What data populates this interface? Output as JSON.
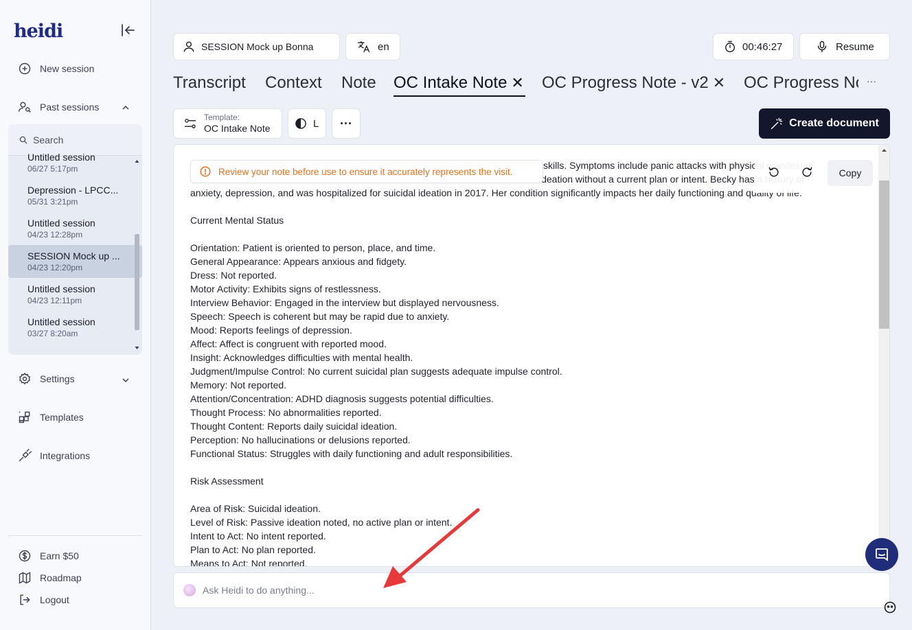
{
  "app": {
    "logo": "heidi"
  },
  "sidebar": {
    "new_session": "New session",
    "past_sessions": "Past sessions",
    "search_placeholder": "Search",
    "sessions": [
      {
        "title": "Untitled session",
        "date": "06/27 5:17pm"
      },
      {
        "title": "Depression - LPCC...",
        "date": "05/31 3:21pm"
      },
      {
        "title": "Untitled session",
        "date": "04/23 12:28pm"
      },
      {
        "title": "SESSION Mock up ...",
        "date": "04/23 12:20pm",
        "active": true
      },
      {
        "title": "Untitled session",
        "date": "04/23 12:11pm"
      },
      {
        "title": "Untitled session",
        "date": "03/27 8:20am"
      }
    ],
    "settings": "Settings",
    "templates": "Templates",
    "integrations": "Integrations",
    "earn": "Earn $50",
    "roadmap": "Roadmap",
    "logout": "Logout"
  },
  "topbar": {
    "session_name": "SESSION Mock up Bonna",
    "language": "en",
    "timer": "00:46:27",
    "resume": "Resume"
  },
  "tabs": [
    {
      "label": "Transcript"
    },
    {
      "label": "Context"
    },
    {
      "label": "Note"
    },
    {
      "label": "OC Intake Note",
      "closable": true,
      "active": true
    },
    {
      "label": "OC Progress Note - v2",
      "closable": true
    },
    {
      "label": "OC Progress Note"
    }
  ],
  "tabs_more": "···",
  "close_glyph": "✕",
  "toolbar": {
    "template_label": "Template:",
    "template_value": "OC Intake Note",
    "size_label": "L",
    "more": "···",
    "create_document": "Create document"
  },
  "document": {
    "warning": "Review your note before use to ensure it accurately represents the visit.",
    "copy": "Copy",
    "lines": [
      "skills. Symptoms include panic attacks with physical manifestat",
      "ideation without a current plan or intent. Becky has a history of",
      "anxiety, depression, and was hospitalized for suicidal ideation in 2017. Her condition significantly impacts her daily functioning and quality of life.",
      "",
      "Current Mental Status",
      "",
      "Orientation: Patient is oriented to person, place, and time.",
      "General Appearance: Appears anxious and fidgety.",
      "Dress: Not reported.",
      "Motor Activity: Exhibits signs of restlessness.",
      "Interview Behavior: Engaged in the interview but displayed nervousness.",
      "Speech: Speech is coherent but may be rapid due to anxiety.",
      "Mood: Reports feelings of depression.",
      "Affect: Affect is congruent with reported mood.",
      "Insight: Acknowledges difficulties with mental health.",
      "Judgment/Impulse Control: No current suicidal plan suggests adequate impulse control.",
      "Memory: Not reported.",
      "Attention/Concentration: ADHD diagnosis suggests potential difficulties.",
      "Thought Process: No abnormalities reported.",
      "Thought Content: Reports daily suicidal ideation.",
      "Perception: No hallucinations or delusions reported.",
      "Functional Status: Struggles with daily functioning and adult responsibilities.",
      "",
      "Risk Assessment",
      "",
      "Area of Risk: Suicidal ideation.",
      "Level of Risk: Passive ideation noted, no active plan or intent.",
      "Intent to Act: No intent reported.",
      "Plan to Act: No plan reported.",
      "Means to Act: Not reported."
    ]
  },
  "ask_placeholder": "Ask Heidi to do anything...",
  "colors": {
    "warning": "#e8711d",
    "primary_dark": "#12172b",
    "chat": "#1f2d7a",
    "arrow": "#e8393a"
  }
}
